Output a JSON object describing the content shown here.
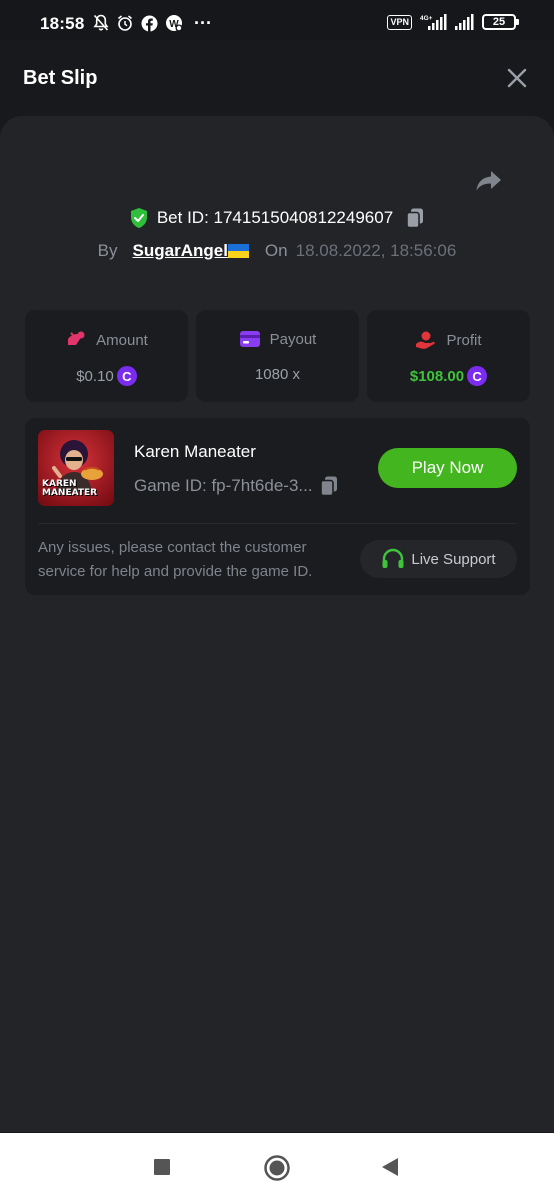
{
  "status_bar": {
    "time": "18:58",
    "vpn_label": "VPN",
    "network_label": "4G+",
    "battery": "25",
    "more": "···"
  },
  "header": {
    "title": "Bet Slip"
  },
  "bet": {
    "bet_id": "Bet ID: 1741515040812249607",
    "by_label": "By",
    "username": "SugarAngel",
    "on_label": "On",
    "date": "18.08.2022, 18:56:06"
  },
  "stats": {
    "amount_label": "Amount",
    "amount_value": "$0.10",
    "payout_label": "Payout",
    "payout_value": "1080 x",
    "profit_label": "Profit",
    "profit_value": "$108.00",
    "coin_symbol": "C"
  },
  "game": {
    "name": "Karen Maneater",
    "thumb_text_line1": "KAREN",
    "thumb_text_line2": "MANEATER",
    "game_id": "Game ID: fp-7ht6de-3...",
    "play_label": "Play Now",
    "help_text": "Any issues, please contact the customer service for help and provide the game ID.",
    "live_support_label": "Live Support"
  },
  "colors": {
    "background": "#18191c",
    "card": "#232428",
    "tile": "#1b1c1f",
    "accent_green": "#43b51f",
    "profit_green": "#3ec33a",
    "coin_purple": "#7b2cf0"
  }
}
